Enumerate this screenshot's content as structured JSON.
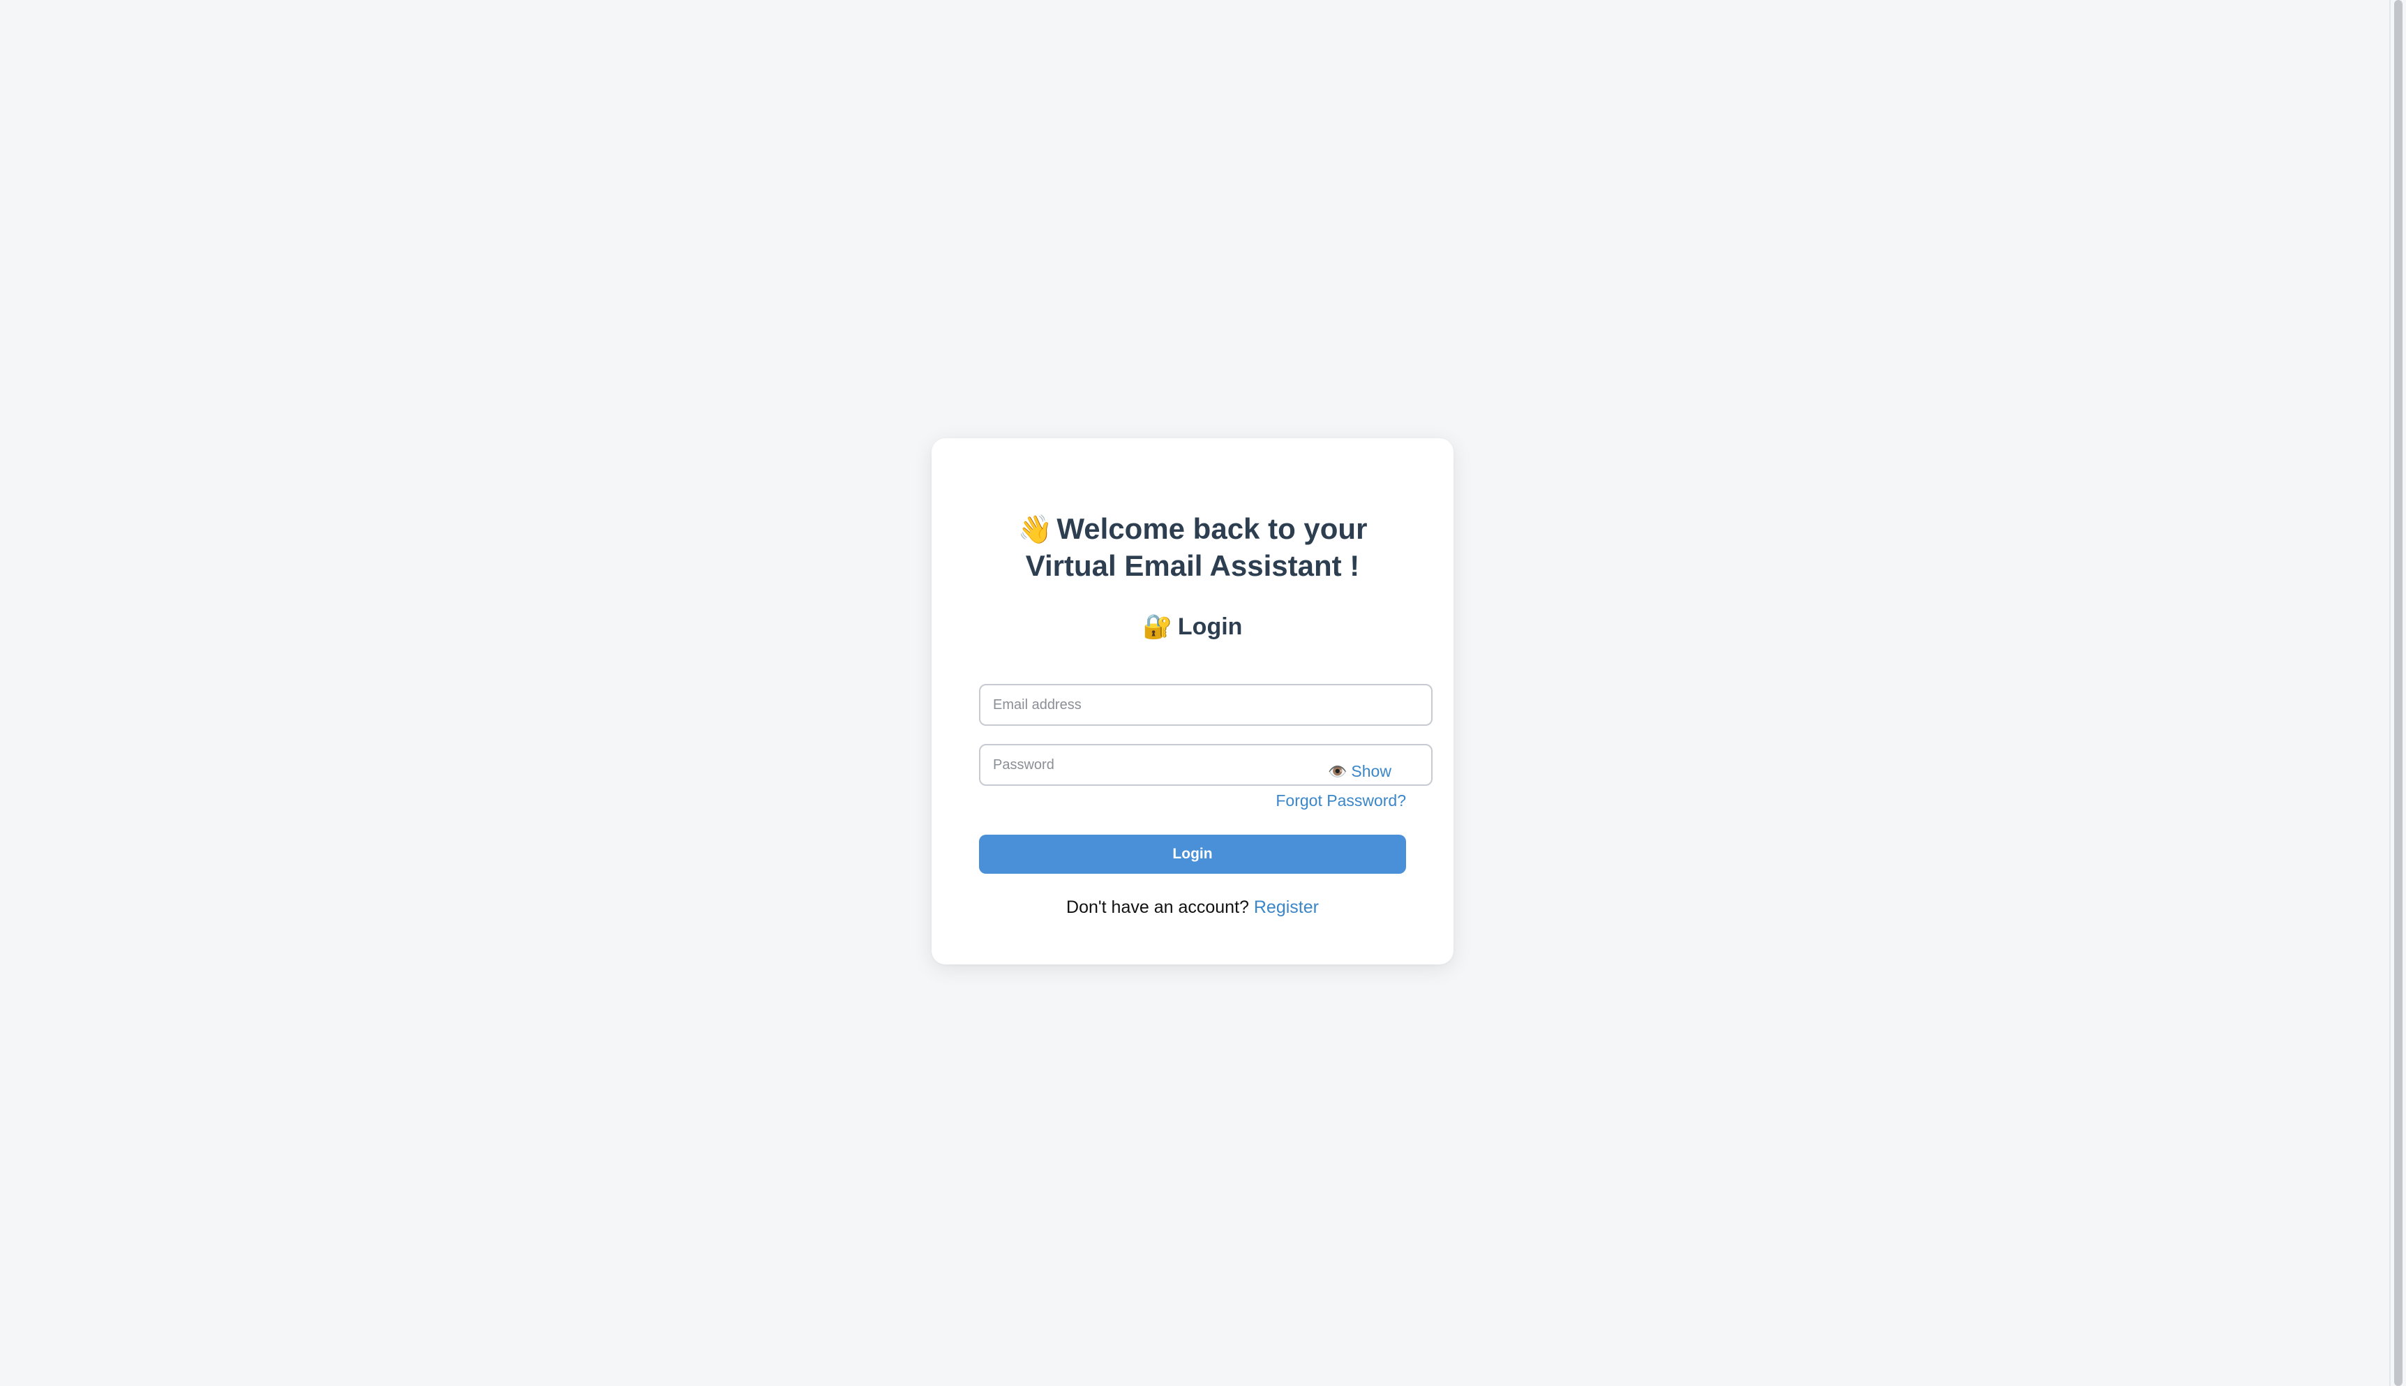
{
  "page": {
    "background_color": "#f4f6f8"
  },
  "card": {
    "welcome_icon": "👋",
    "welcome_icon_name": "waving-hand-icon",
    "welcome_line1": "Welcome back to your",
    "welcome_line2": "Virtual Email Assistant !",
    "login_icon": "🔐",
    "login_icon_name": "locked-with-key-icon",
    "login_heading": "Login"
  },
  "form": {
    "email": {
      "value": "",
      "placeholder": "Email address"
    },
    "password": {
      "value": "",
      "placeholder": "Password"
    },
    "show_toggle": {
      "icon": "👁️",
      "icon_name": "eye-icon",
      "label": "Show"
    },
    "forgot_password_label": "Forgot Password?",
    "submit_label": "Login"
  },
  "footer": {
    "prompt": "Don't have an account?",
    "register_label": "Register"
  },
  "colors": {
    "accent": "#4a90d9",
    "link": "#3a86c8",
    "heading": "#2c3e50"
  }
}
